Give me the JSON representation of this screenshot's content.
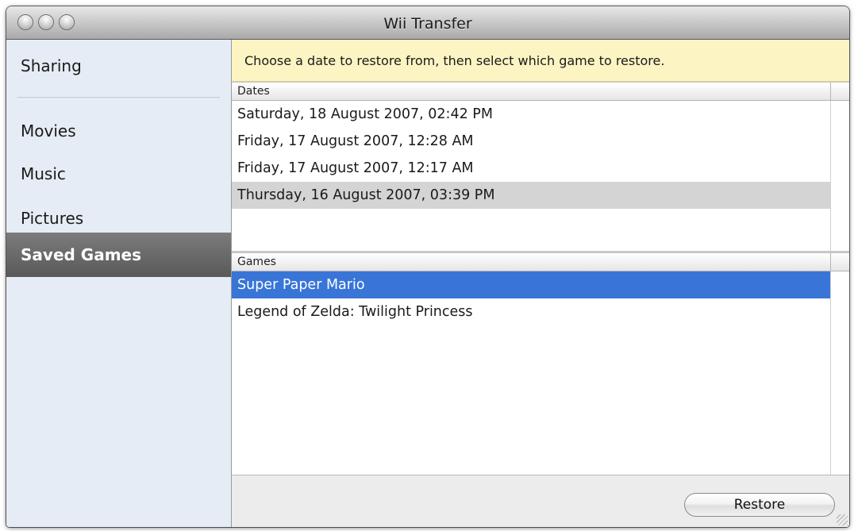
{
  "window": {
    "title": "Wii Transfer"
  },
  "sidebar": {
    "items": [
      {
        "label": "Sharing"
      },
      {
        "label": "Movies"
      },
      {
        "label": "Music"
      },
      {
        "label": "Pictures"
      },
      {
        "label": "Saved Games",
        "selected": true
      }
    ]
  },
  "main": {
    "hint": "Choose a date to restore from, then select which game to restore.",
    "dates": {
      "header": "Dates",
      "rows": [
        "Saturday, 18 August 2007, 02:42 PM",
        "Friday, 17 August 2007, 12:28 AM",
        "Friday, 17 August 2007, 12:17 AM",
        "Thursday, 16 August 2007, 03:39 PM"
      ],
      "selected_index": 3
    },
    "games": {
      "header": "Games",
      "rows": [
        "Super Paper Mario",
        "Legend of Zelda: Twilight Princess"
      ],
      "selected_index": 0
    },
    "restore_label": "Restore"
  },
  "colors": {
    "selection_blue": "#3875d7",
    "selection_gray": "#d4d4d4",
    "hint_bg": "#fcf4c3",
    "sidebar_bg": "#e5ecf5",
    "sidebar_selected": "#666666"
  },
  "icons": {
    "close": "close-traffic-light-icon",
    "minimize": "minimize-traffic-light-icon",
    "zoom": "zoom-traffic-light-icon",
    "resize": "resize-grip-icon"
  }
}
